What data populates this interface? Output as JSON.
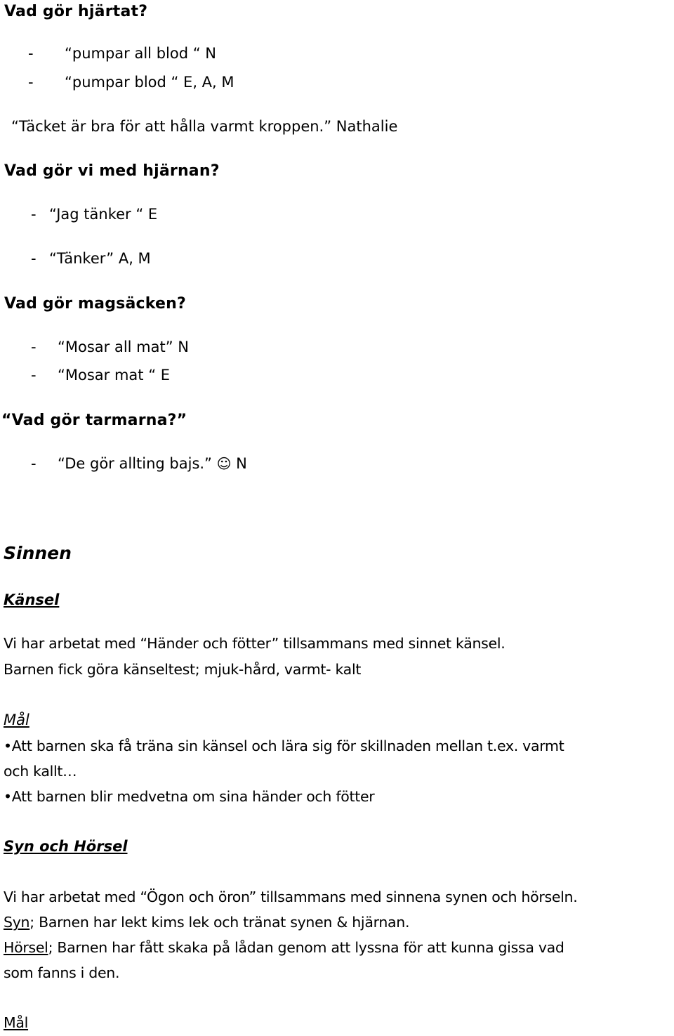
{
  "sections": {
    "heart": {
      "question": "Vad gör hjärtat?",
      "answers": [
        {
          "dash": "-",
          "text": "“pumpar all blod “ N"
        },
        {
          "dash": "-",
          "text": "“pumpar blod “ E, A, M"
        }
      ],
      "quote": "“Täcket är bra för att hålla varmt kroppen.” Nathalie"
    },
    "brain": {
      "question": "Vad gör vi med hjärnan?",
      "answers": [
        {
          "dash": "-",
          "text": "“Jag tänker “ E"
        },
        {
          "dash": "-",
          "text": "“Tänker” A, M"
        }
      ]
    },
    "stomach": {
      "question": "Vad gör magsäcken?",
      "answers": [
        {
          "dash": "-",
          "text": "“Mosar all mat” N"
        },
        {
          "dash": "-",
          "text": "“Mosar mat “ E"
        }
      ]
    },
    "intestines": {
      "question": "“Vad gör tarmarna?”",
      "answers": [
        {
          "dash": "-",
          "text": "“De gör allting bajs.”",
          "icon": "smiley-icon",
          "glyph": "☺",
          "suffix": "N"
        }
      ]
    }
  },
  "senses": {
    "title": "Sinnen",
    "touch": {
      "heading": "Känsel",
      "lines": [
        "Vi har arbetat med “Händer och fötter” tillsammans med sinnet känsel.",
        "Barnen fick göra känseltest; mjuk-hård, varmt- kalt"
      ],
      "goal_heading": "Mål",
      "goals": [
        "•Att barnen ska få träna sin känsel och lära sig för skillnaden mellan t.ex. varmt",
        "och kallt…",
        "•Att barnen blir medvetna om sina händer och fötter"
      ]
    },
    "sight_hearing": {
      "heading": "Syn och Hörsel",
      "intro": "Vi har arbetat med “Ögon och öron” tillsammans med sinnena synen och hörseln.",
      "sight_label": "Syn",
      "sight_text": "; Barnen har lekt kims lek och tränat synen & hjärnan.",
      "hearing_label": "Hörsel",
      "hearing_text": "; Barnen har fått skaka på lådan genom att lyssna för att kunna gissa vad",
      "hearing_text_cont": "som fanns i den.",
      "goal_heading": "Mål"
    }
  }
}
